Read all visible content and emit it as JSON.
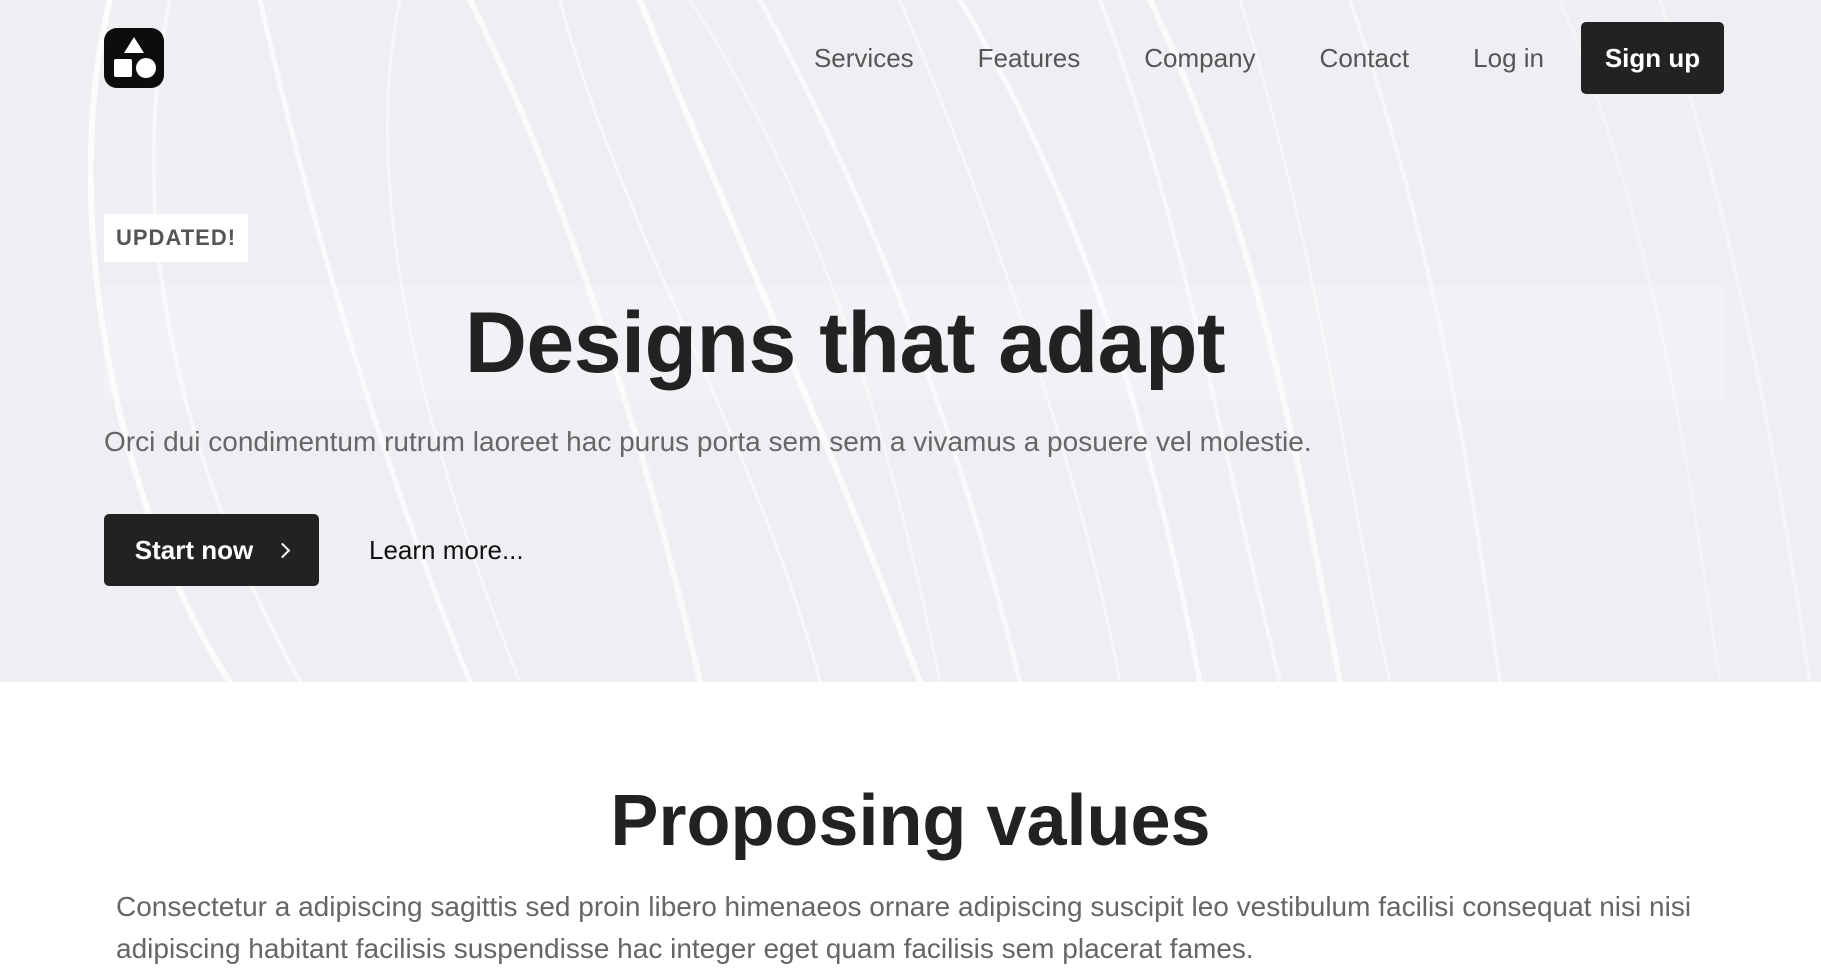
{
  "colors": {
    "hero_background": "#eeeff2",
    "primary_button": "#222222",
    "text_dark": "#222222",
    "text_muted": "#666666"
  },
  "logo": {
    "icon": "shapes-logo-icon"
  },
  "nav": {
    "links": [
      "Services",
      "Features",
      "Company",
      "Contact",
      "Log in"
    ],
    "signup_label": "Sign up"
  },
  "hero": {
    "badge": "UPDATED!",
    "title": "Designs that adapt",
    "subtitle": "Orci dui condimentum rutrum laoreet hac purus porta sem sem a vivamus a posuere vel molestie.",
    "primary_cta": "Start now",
    "primary_cta_icon": "chevron-right-icon",
    "secondary_cta": "Learn more..."
  },
  "values": {
    "title": "Proposing values",
    "description": "Consectetur a adipiscing sagittis sed proin libero himenaeos ornare adipiscing suscipit leo vestibulum facilisi consequat nisi nisi adipiscing habitant facilisis suspendisse hac integer eget quam facilisis sem placerat fames."
  }
}
